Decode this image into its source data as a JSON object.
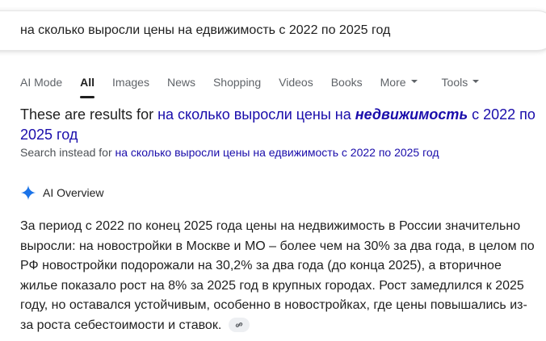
{
  "search": {
    "query": "на сколько выросли цены на едвижимость с 2022 по 2025 год"
  },
  "tabs": [
    {
      "label": "AI Mode"
    },
    {
      "label": "All"
    },
    {
      "label": "Images"
    },
    {
      "label": "News"
    },
    {
      "label": "Shopping"
    },
    {
      "label": "Videos"
    },
    {
      "label": "Books"
    },
    {
      "label": "More"
    },
    {
      "label": "Tools"
    }
  ],
  "correction": {
    "prefix": "These are results for",
    "corrected_before": "на сколько выросли цены на",
    "corrected_bold": "недвижимость",
    "corrected_after": "с 2022 по 2025 год",
    "instead_prefix": "Search instead for",
    "instead_query": "на сколько выросли цены на едвижимость с 2022 по 2025 год"
  },
  "ai_overview": {
    "title": "AI Overview",
    "text": "За период с 2022 по конец 2025 года цены на недвижимость в России значительно выросли: на новостройки в Москве и МО – более чем на 30% за два года, в целом по РФ новостройки подорожали на 30,2% за два года (до конца 2025), а вторичное жилье показало рост на 8% за 2025 год в крупных городах. Рост замедлился к 2025 году, но оставался устойчивым, особенно в новостройках, где цены повышались из-за роста себестоимости и ставок.",
    "link_icon": "link-icon"
  },
  "colors": {
    "link": "#1a0dab",
    "text": "#1f1f1f",
    "muted": "#5f6368",
    "sparkle": "#1a73e8"
  }
}
